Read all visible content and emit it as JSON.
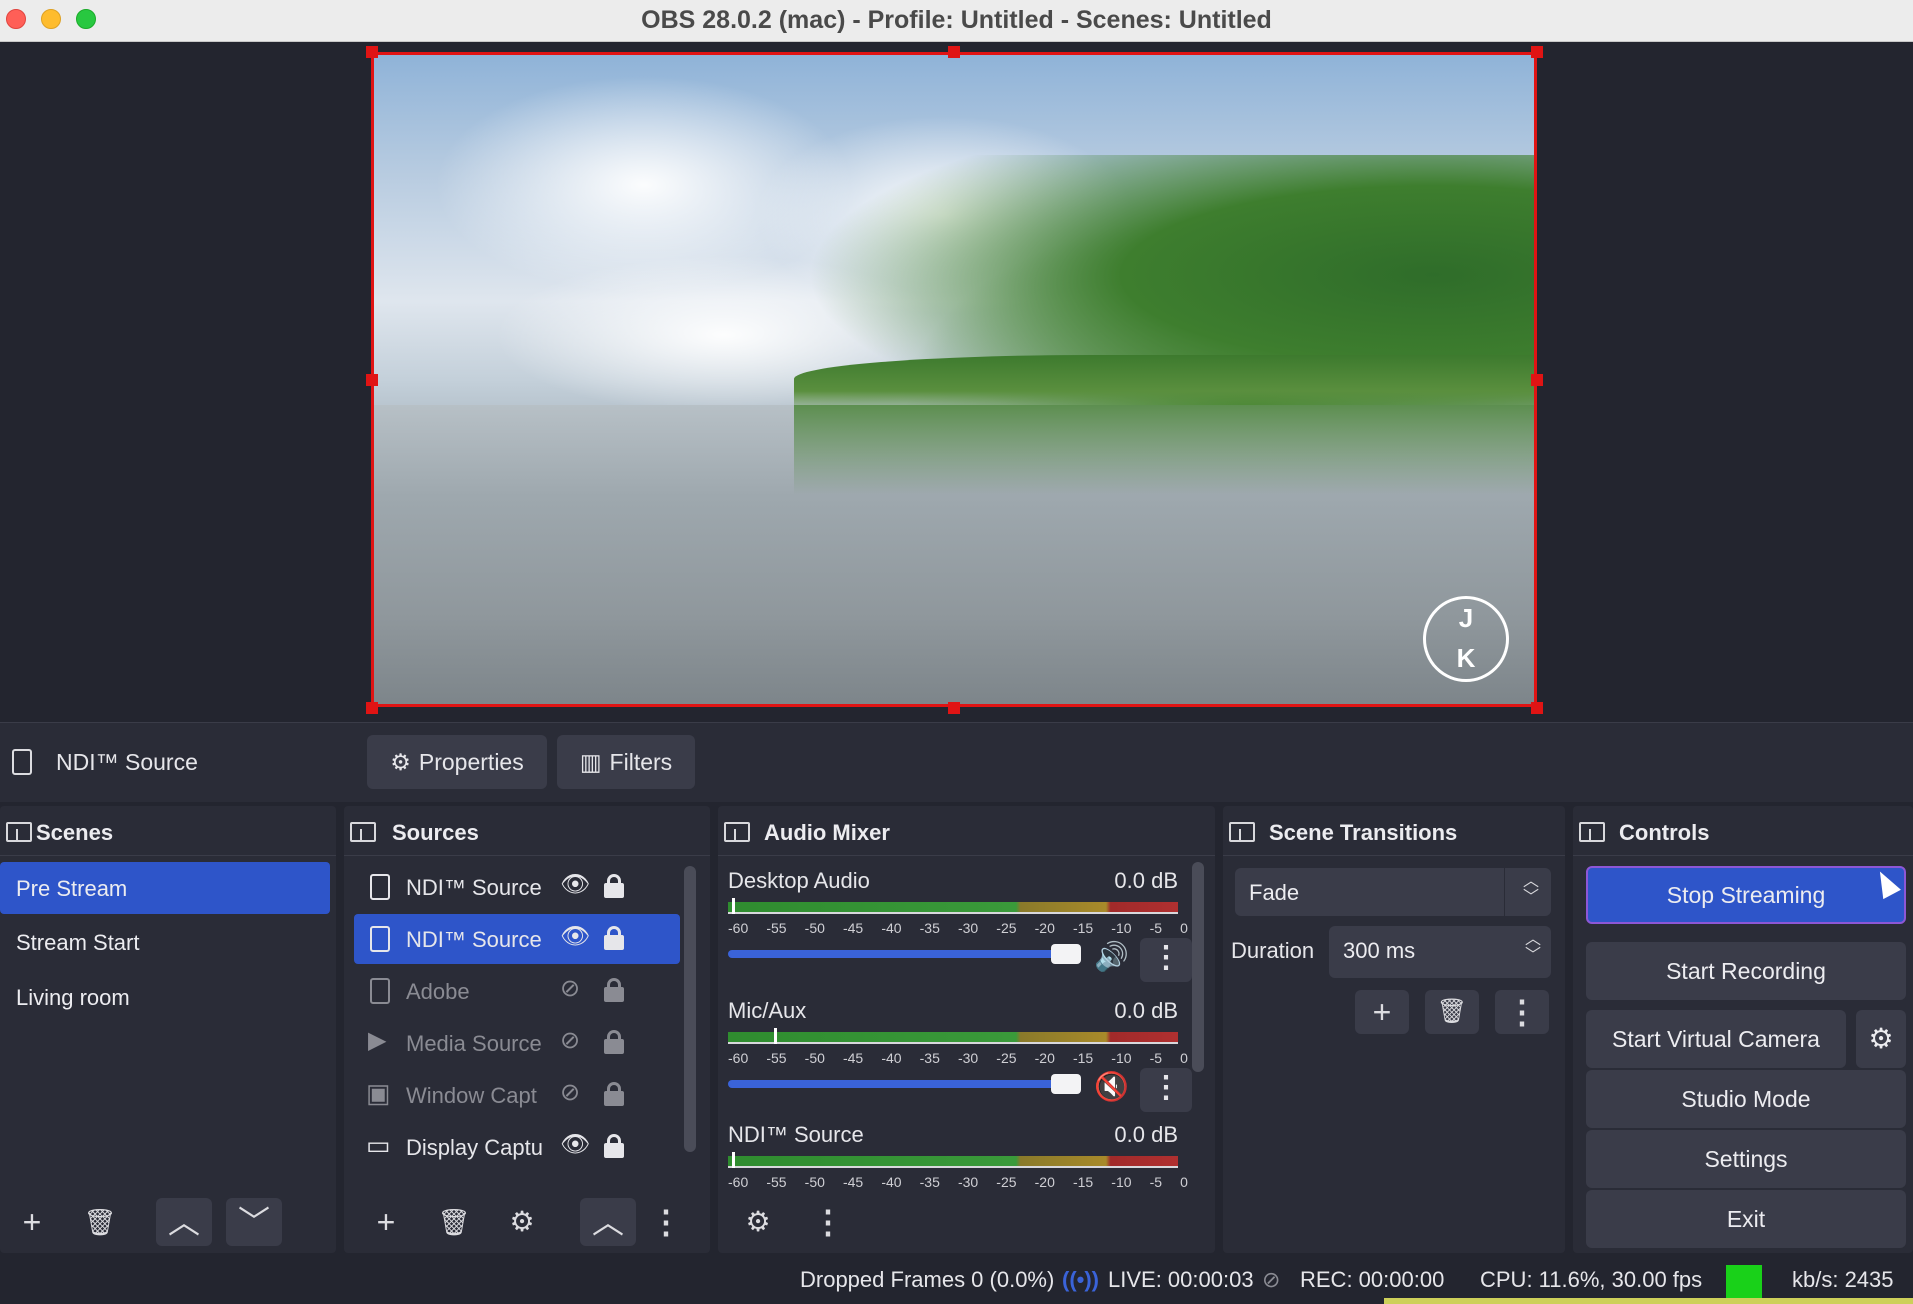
{
  "window": {
    "title": "OBS 28.0.2 (mac) - Profile: Untitled - Scenes: Untitled"
  },
  "source_bar": {
    "selected_source": "NDI™ Source",
    "properties_label": "Properties",
    "filters_label": "Filters"
  },
  "preview": {
    "logo_text_top": "J",
    "logo_text_bottom": "K"
  },
  "scenes": {
    "title": "Scenes",
    "items": [
      {
        "label": "Pre Stream"
      },
      {
        "label": "Stream Start"
      },
      {
        "label": "Living room"
      }
    ]
  },
  "sources": {
    "title": "Sources",
    "items": [
      {
        "label": "NDI™ Source"
      },
      {
        "label": "NDI™ Source"
      },
      {
        "label": "Adobe"
      },
      {
        "label": "Media Source"
      },
      {
        "label": "Window Capt"
      },
      {
        "label": "Display Captu"
      }
    ]
  },
  "audio_mixer": {
    "title": "Audio Mixer",
    "ticks": [
      "-60",
      "-55",
      "-50",
      "-45",
      "-40",
      "-35",
      "-30",
      "-25",
      "-20",
      "-15",
      "-10",
      "-5",
      "0"
    ],
    "channels": [
      {
        "name": "Desktop Audio",
        "db": "0.0 dB",
        "volume": 1.0,
        "muted": false
      },
      {
        "name": "Mic/Aux",
        "db": "0.0 dB",
        "volume": 1.0,
        "muted": true
      },
      {
        "name": "NDI™ Source",
        "db": "0.0 dB",
        "volume": 1.0,
        "muted": false
      }
    ]
  },
  "scene_transitions": {
    "title": "Scene Transitions",
    "transition": "Fade",
    "duration_label": "Duration",
    "duration_value": "300 ms"
  },
  "controls": {
    "title": "Controls",
    "stop_streaming": "Stop Streaming",
    "start_recording": "Start Recording",
    "start_virtual_camera": "Start Virtual Camera",
    "studio_mode": "Studio Mode",
    "settings": "Settings",
    "exit": "Exit"
  },
  "status": {
    "dropped_frames": "Dropped Frames 0 (0.0%)",
    "live": "LIVE: 00:00:03",
    "rec": "REC: 00:00:00",
    "cpu": "CPU: 11.6%, 30.00 fps",
    "kbps": "kb/s: 2435"
  },
  "colors": {
    "accent": "#2e55c9",
    "record_border": "#e01414",
    "live_indicator": "#19d119"
  }
}
